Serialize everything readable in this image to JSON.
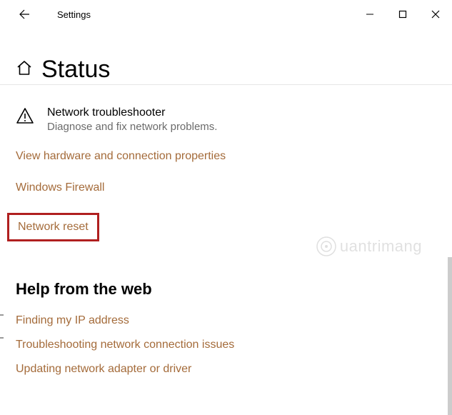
{
  "titlebar": {
    "app_name": "Settings"
  },
  "page": {
    "title": "Status"
  },
  "troubleshooter": {
    "title": "Network troubleshooter",
    "subtitle": "Diagnose and fix network problems."
  },
  "links": {
    "view_hardware": "View hardware and connection properties",
    "firewall": "Windows Firewall",
    "network_reset": "Network reset"
  },
  "help_section": {
    "title": "Help from the web",
    "items": [
      "Finding my IP address",
      "Troubleshooting network connection issues",
      "Updating network adapter or driver"
    ]
  },
  "watermark": "uantrimang"
}
